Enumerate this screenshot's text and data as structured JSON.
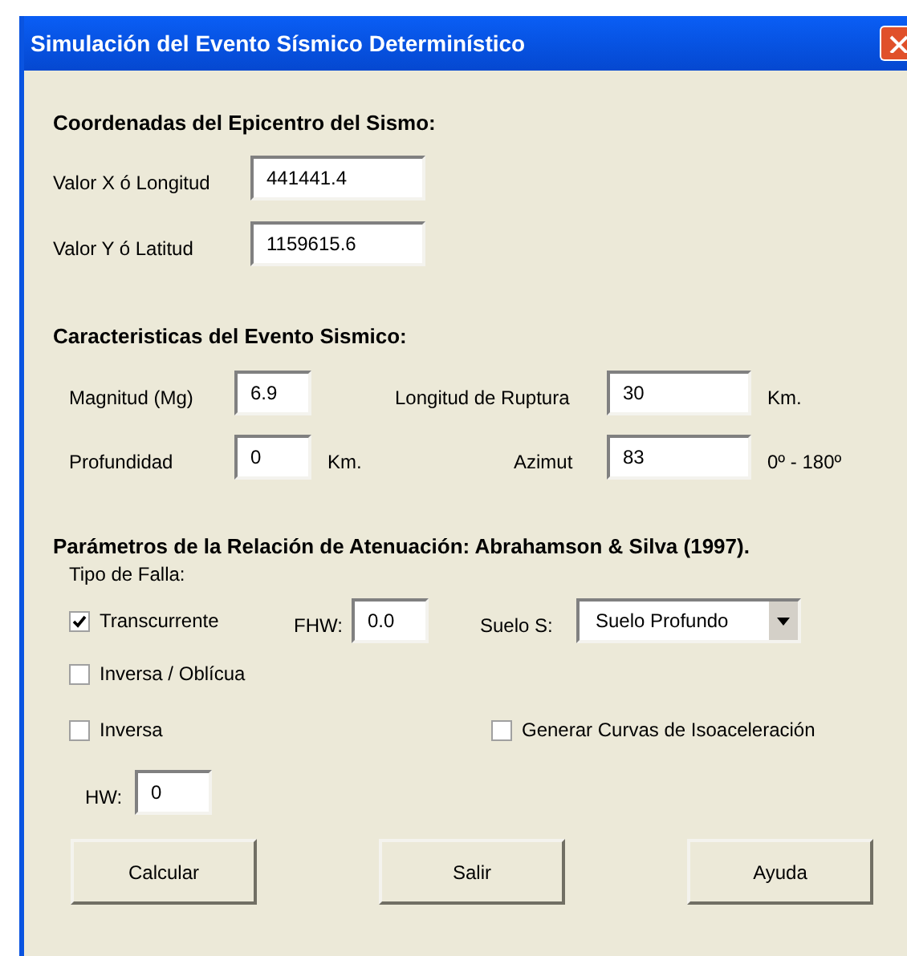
{
  "window": {
    "title": "Simulación del Evento Sísmico Determinístico"
  },
  "epicenter": {
    "heading": "Coordenadas del Epicentro del Sismo:",
    "fields": [
      {
        "label": "Valor X ó Longitud",
        "value": "441441.4"
      },
      {
        "label": "Valor Y ó Latitud",
        "value": "1159615.6"
      }
    ]
  },
  "event": {
    "heading": "Caracteristicas del Evento Sismico:",
    "magnitude": {
      "label": "Magnitud (Mg)",
      "value": "6.9"
    },
    "rupture_length": {
      "label": "Longitud de Ruptura",
      "value": "30",
      "unit": "Km."
    },
    "depth": {
      "label": "Profundidad",
      "value": "0",
      "unit": "Km."
    },
    "azimuth": {
      "label": "Azimut",
      "value": "83",
      "unit": "0º - 180º"
    }
  },
  "attenuation": {
    "heading": "Parámetros de la Relación de Atenuación: Abrahamson & Silva (1997).",
    "fault_type_label": "Tipo de Falla:",
    "fault_types": [
      {
        "label": "Transcurrente",
        "checked": true
      },
      {
        "label": "Inversa / Oblícua",
        "checked": false
      },
      {
        "label": "Inversa",
        "checked": false
      }
    ],
    "fhw": {
      "label": "FHW:",
      "value": "0.0"
    },
    "soil": {
      "label": "Suelo S:",
      "value": "Suelo Profundo"
    },
    "isoacceleration": {
      "label": "Generar Curvas de Isoaceleración",
      "checked": false
    },
    "hw": {
      "label": "HW:",
      "value": "0"
    }
  },
  "buttons": [
    "Calcular",
    "Salir",
    "Ayuda"
  ]
}
